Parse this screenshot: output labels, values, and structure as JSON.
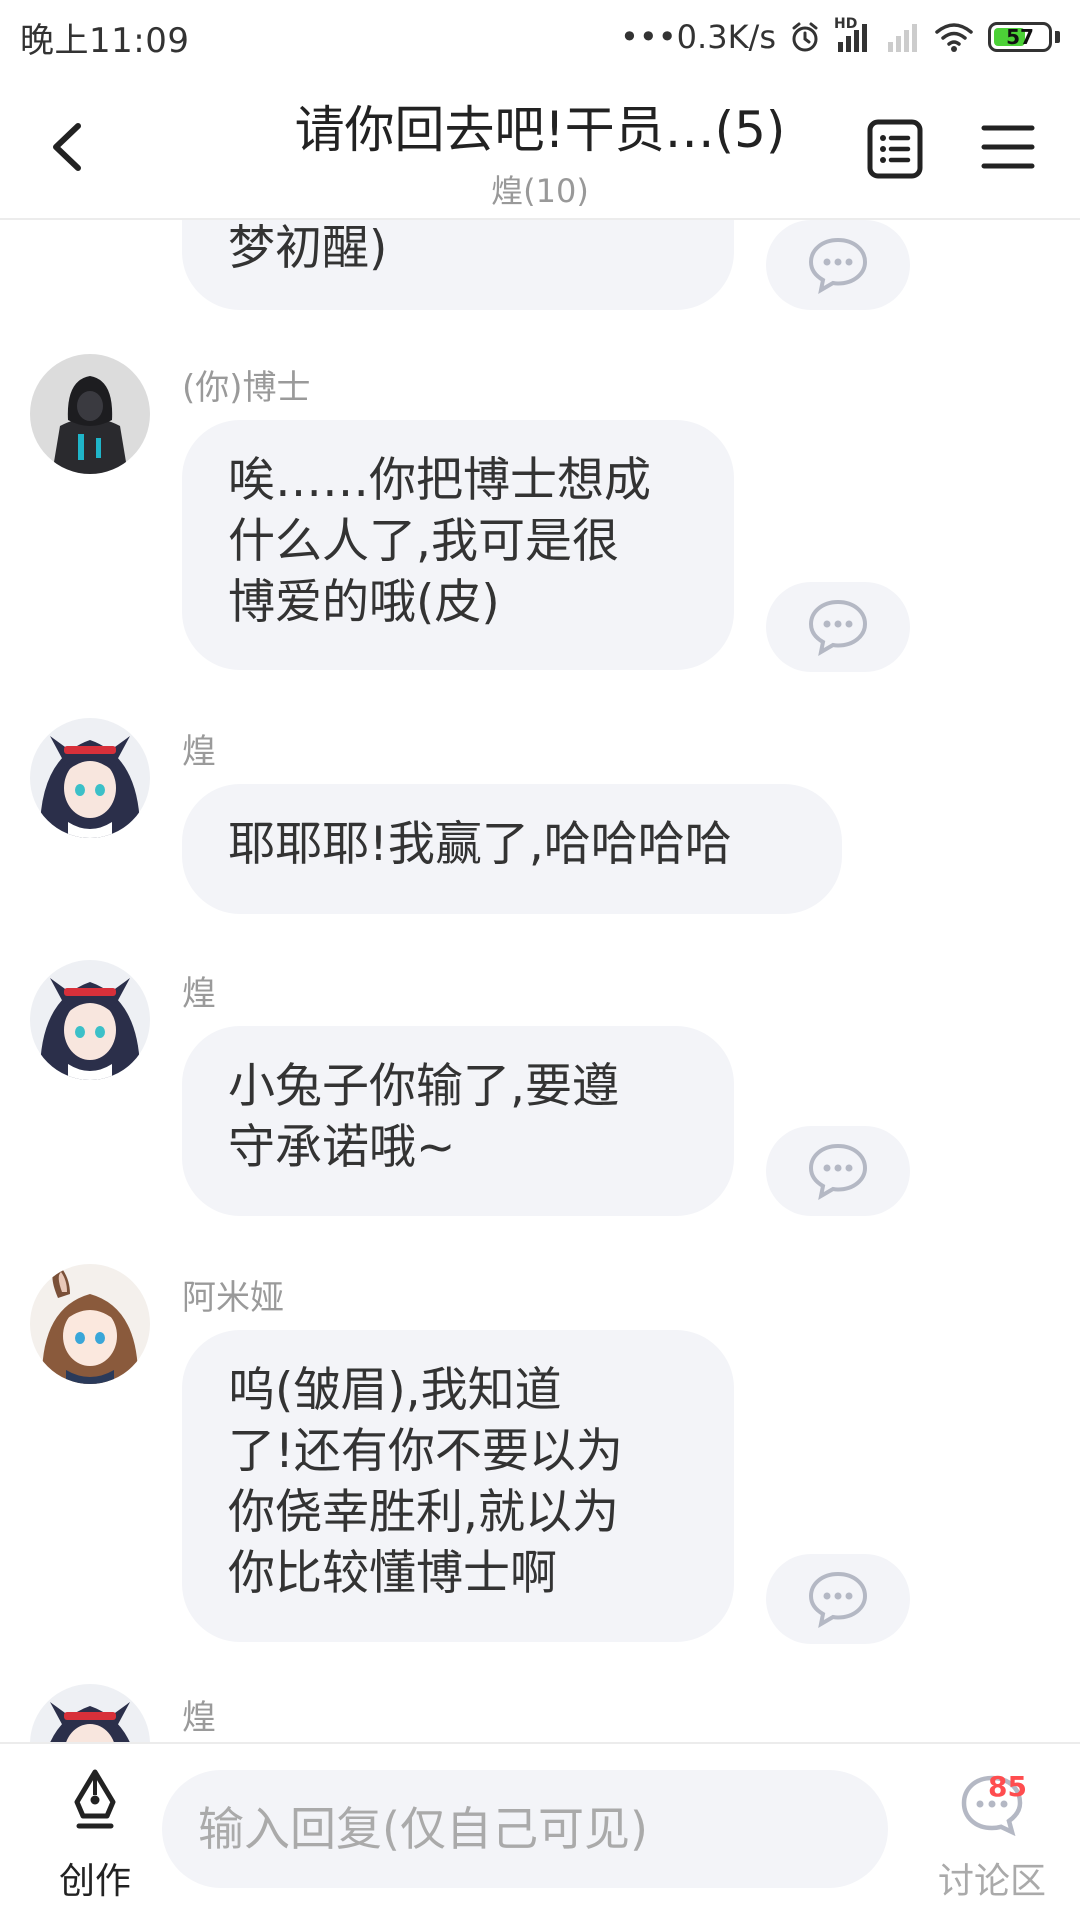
{
  "status_bar": {
    "time": "晚上11:09",
    "network_speed": "•••0.3K/s",
    "alarm_icon": "alarm-icon",
    "hd_label": "HD",
    "battery_level": "57"
  },
  "header": {
    "back_icon": "chevron-left-icon",
    "title": "请你回去吧!干员…(5)",
    "subtitle": "煌(10)",
    "list_icon": "list-icon",
    "menu_icon": "menu-icon"
  },
  "messages": [
    {
      "sender": "",
      "lines": [
        "梦初醒)"
      ],
      "has_comment": true
    },
    {
      "sender": "(你)博士",
      "avatar": "avatar-doctor",
      "lines": [
        "唉……你把博士想成",
        "什么人了,我可是很",
        "博爱的哦(皮)"
      ],
      "has_comment": true
    },
    {
      "sender": "煌",
      "avatar": "avatar-blaze",
      "lines": [
        "耶耶耶!我赢了,哈哈哈哈"
      ],
      "has_comment": false
    },
    {
      "sender": "煌",
      "avatar": "avatar-blaze",
      "lines": [
        "小兔子你输了,要遵",
        "守承诺哦~"
      ],
      "has_comment": true
    },
    {
      "sender": "阿米娅",
      "avatar": "avatar-amiya",
      "lines": [
        "呜(皱眉),我知道",
        "了!还有你不要以为",
        "你侥幸胜利,就以为",
        "你比较懂博士啊"
      ],
      "has_comment": true
    },
    {
      "sender": "煌",
      "avatar": "avatar-blaze",
      "lines": [],
      "has_comment": false
    }
  ],
  "bottom_bar": {
    "create_label": "创作",
    "reply_placeholder": "输入回复(仅自己可见)",
    "discuss_label": "讨论区",
    "discuss_badge": "85"
  },
  "colors": {
    "bubble_bg": "#f3f4f8",
    "badge": "#ff4d4f",
    "battery_fill": "#4cd137"
  }
}
